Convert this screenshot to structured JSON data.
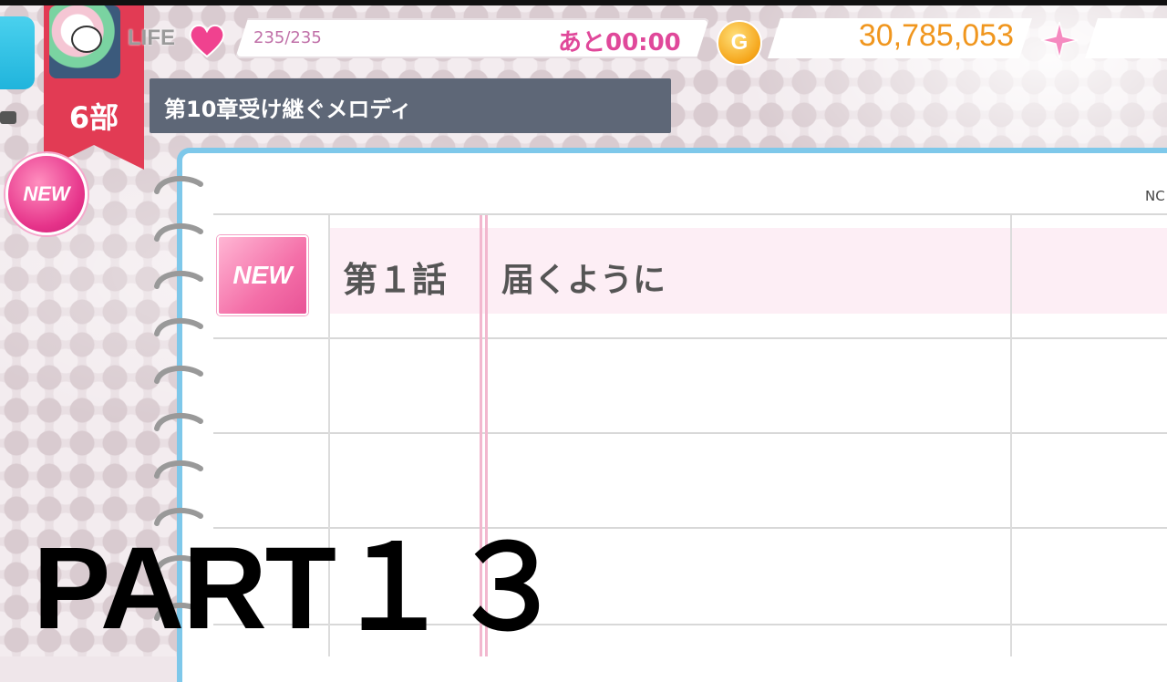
{
  "status_bar": {
    "life_label": "LIFE",
    "life_value": "235/235",
    "life_timer": "あと00:00",
    "coin_icon_label": "G",
    "coin_value": "30,785,053"
  },
  "header": {
    "part_label": "6部",
    "chapter_title": "第10章受け継ぐメロディ"
  },
  "badges": {
    "new_circle": "NEW"
  },
  "notebook": {
    "corner_label": "NC",
    "episodes": [
      {
        "badge": "NEW",
        "number": "第１話",
        "title": "届くように"
      }
    ]
  },
  "overlay": {
    "text": "PART１３"
  },
  "colors": {
    "accent_pink": "#e6338a",
    "banner_red": "#e23b54",
    "notebook_border": "#7ec8ea",
    "coin_gold": "#f0961e"
  },
  "icons": [
    "heart-icon",
    "coin-icon",
    "star-icon",
    "back-arrow-icon"
  ]
}
